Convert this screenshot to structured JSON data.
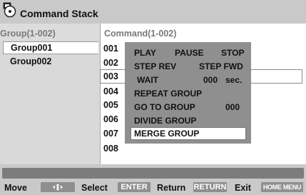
{
  "window": {
    "title": "Command Stack",
    "icon": "disc-menu-icon"
  },
  "groups": {
    "header": "Group(1-002)",
    "items": [
      {
        "label": "Group001",
        "selected": true
      },
      {
        "label": "Group002",
        "selected": false
      }
    ]
  },
  "commands": {
    "header": "Command(1-002)",
    "rows": [
      "001",
      "002",
      "003",
      "004",
      "005",
      "006",
      "007",
      "008"
    ],
    "selected_row": "003"
  },
  "popup_menu": {
    "play": "PLAY",
    "pause": "PAUSE",
    "stop": "STOP",
    "step_rev": "STEP REV",
    "step_fwd": "STEP FWD",
    "wait": "WAIT",
    "wait_value": "000",
    "wait_unit": "sec.",
    "repeat_group": "REPEAT GROUP",
    "go_to_group": "GO TO GROUP",
    "go_to_value": "000",
    "divide_group": "DIVIDE GROUP",
    "merge_group": "MERGE GROUP",
    "highlighted": "MERGE GROUP"
  },
  "bottom_bar": {
    "move_label": "Move",
    "move_key_icon": "arrow-keys-icon",
    "select_label": "Select",
    "select_key": "ENTER",
    "return_label": "Return",
    "return_key": "RETURN",
    "exit_label": "Exit",
    "exit_key": "HOME MENU"
  }
}
